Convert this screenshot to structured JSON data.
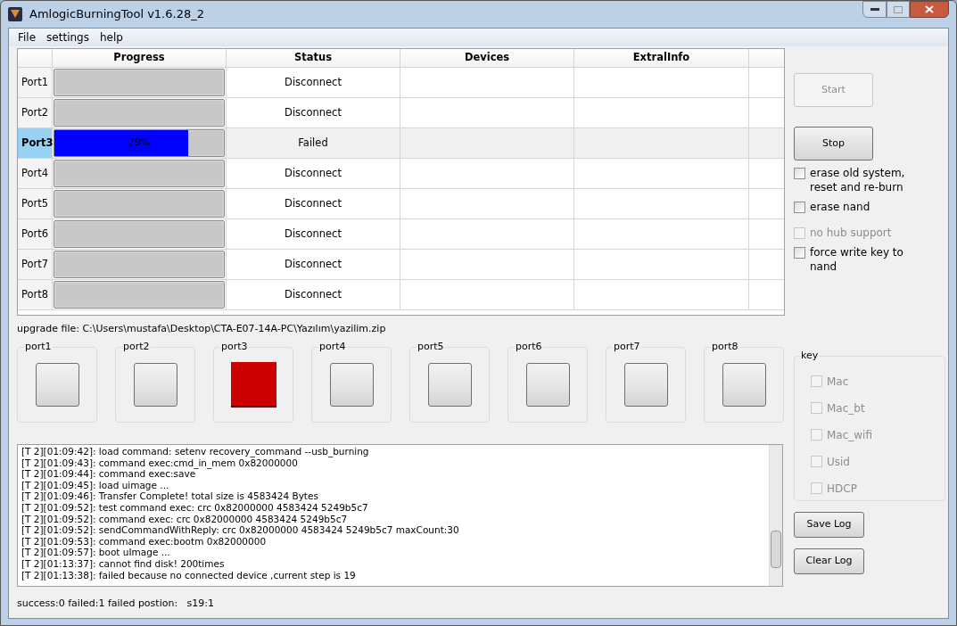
{
  "window": {
    "title": "AmlogicBurningTool  v1.6.28_2"
  },
  "menu": [
    "File",
    "settings",
    "help"
  ],
  "table": {
    "columns": [
      "Progress",
      "Status",
      "Devices",
      "ExtralInfo"
    ],
    "rows": [
      {
        "port": "Port1",
        "selected": false,
        "level": 0,
        "status": "Disconnect"
      },
      {
        "port": "Port2",
        "selected": false,
        "level": 0,
        "status": "Disconnect"
      },
      {
        "port": "Port3",
        "selected": true,
        "level": 0.79,
        "progress_text": "79%",
        "status": "Failed"
      },
      {
        "port": "Port4",
        "selected": false,
        "level": 0,
        "status": "Disconnect"
      },
      {
        "port": "Port5",
        "selected": false,
        "level": 0,
        "status": "Disconnect"
      },
      {
        "port": "Port6",
        "selected": false,
        "level": 0,
        "status": "Disconnect"
      },
      {
        "port": "Port7",
        "selected": false,
        "level": 0,
        "status": "Disconnect"
      },
      {
        "port": "Port8",
        "selected": false,
        "level": 0,
        "status": "Disconnect"
      }
    ]
  },
  "actions": [
    {
      "label": "Start",
      "disabled": true
    },
    {
      "label": "Stop",
      "disabled": false
    }
  ],
  "options": [
    {
      "label": "erase old system, reset and re-burn",
      "checked": false,
      "disabled": false
    },
    {
      "label": "erase nand",
      "checked": false,
      "disabled": false
    },
    {
      "label": "no hub support",
      "checked": false,
      "disabled": true
    },
    {
      "label": "force write key to nand",
      "checked": false,
      "disabled": false
    }
  ],
  "upgrade_file": "upgrade file: C:\\Users\\mustafa\\Desktop\\CTA-E07-14A-PC\\Yazılım\\yazilim.zip",
  "port_indicators": [
    {
      "label": "port1",
      "failed": false
    },
    {
      "label": "port2",
      "failed": false
    },
    {
      "label": "port3",
      "failed": true
    },
    {
      "label": "port4",
      "failed": false
    },
    {
      "label": "port5",
      "failed": false
    },
    {
      "label": "port6",
      "failed": false
    },
    {
      "label": "port7",
      "failed": false
    },
    {
      "label": "port8",
      "failed": false
    }
  ],
  "key_group": {
    "title": "key",
    "items": [
      {
        "label": "Mac",
        "checked": false,
        "disabled": true
      },
      {
        "label": "Mac_bt",
        "checked": false,
        "disabled": true
      },
      {
        "label": "Mac_wifi",
        "checked": false,
        "disabled": true
      },
      {
        "label": "Usid",
        "checked": false,
        "disabled": true
      },
      {
        "label": "HDCP",
        "checked": false,
        "disabled": true
      }
    ]
  },
  "log_buttons": [
    "Save Log",
    "Clear Log"
  ],
  "log": [
    "[T 2][01:09:42]: load command: setenv recovery_command --usb_burning",
    "[T 2][01:09:43]: command exec:cmd_in_mem 0x82000000",
    "[T 2][01:09:44]: command exec:save",
    "[T 2][01:09:45]: load uimage ...",
    "[T 2][01:09:46]: Transfer Complete! total size is 4583424 Bytes",
    "[T 2][01:09:52]: test command exec: crc 0x82000000 4583424 5249b5c7",
    "[T 2][01:09:52]: command exec: crc 0x82000000 4583424 5249b5c7",
    "[T 2][01:09:52]: sendCommandWithReply: crc 0x82000000 4583424 5249b5c7 maxCount:30",
    "[T 2][01:09:53]: command exec:bootm 0x82000000",
    "[T 2][01:09:57]: boot uImage ...",
    "[T 2][01:13:37]: cannot find disk! 200times",
    "[T 2][01:13:38]: failed because no connected device ,current step is 19"
  ],
  "status_bar": "success:0 failed:1 failed postion:   s19:1"
}
